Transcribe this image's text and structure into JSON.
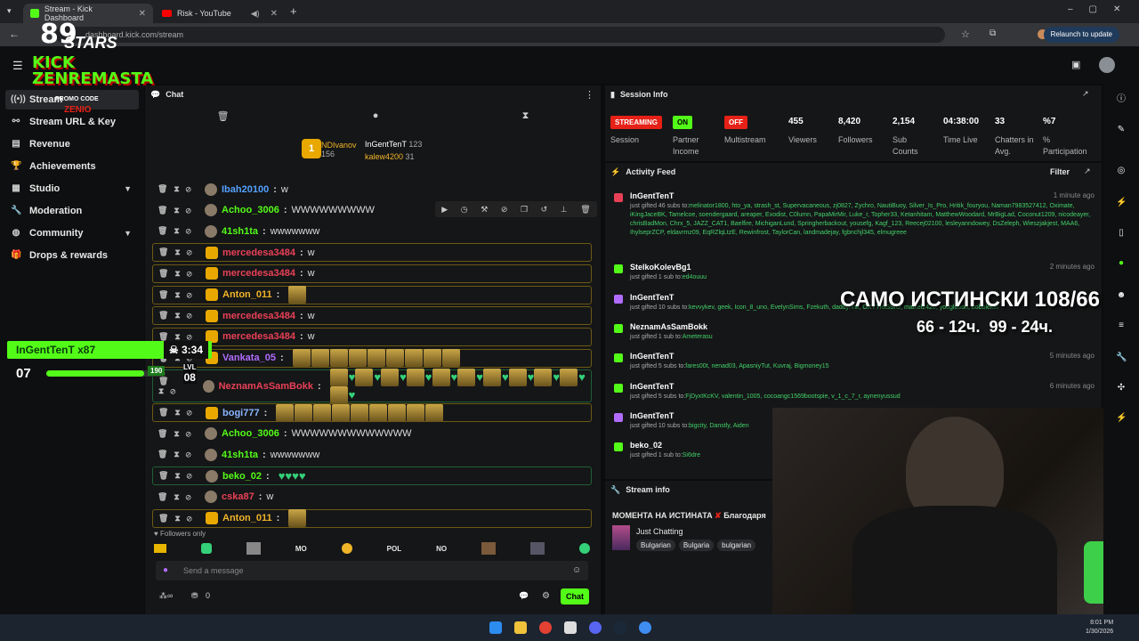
{
  "browser": {
    "tabs": [
      {
        "title": "Stream - Kick Dashboard",
        "color": "#53fc18"
      },
      {
        "title": "Risk - YouTube",
        "color": "#ff0000"
      }
    ],
    "url": "dashboard.kick.com/stream",
    "relaunch_label": "Relaunch to update"
  },
  "overlay": {
    "brand_top": "STARS",
    "brand_num": "89",
    "logo_main": "KICK ZENREMASTA",
    "logo_sub": "PROMO CODE",
    "logo_code": "ZENIO",
    "goal_user": "InGentTenT x87",
    "goal_time": "3:34",
    "level_left": "07",
    "level_right": "08",
    "level_prefix": "LVL",
    "goal_value": "190",
    "big_text": "САМО ИСТИНСКИ 108/66",
    "small_text": "66 - 12ч.  99 - 24ч."
  },
  "sidebar": {
    "items": [
      {
        "label": "Stream",
        "icon": "broadcast-icon"
      },
      {
        "label": "Stream URL & Key",
        "icon": "link-icon"
      },
      {
        "label": "Revenue",
        "icon": "chart-icon"
      },
      {
        "label": "Achievements",
        "icon": "trophy-icon"
      },
      {
        "label": "Studio",
        "icon": "layout-icon"
      },
      {
        "label": "Moderation",
        "icon": "wrench-icon"
      },
      {
        "label": "Community",
        "icon": "globe-icon"
      },
      {
        "label": "Drops & rewards",
        "icon": "gift-icon"
      }
    ]
  },
  "chat": {
    "title": "Chat",
    "leaderboard": [
      {
        "name": "NDIvanov",
        "count": "156"
      },
      {
        "name": "InGentTenT",
        "count": "123"
      },
      {
        "name": "kalew4200",
        "count": "31"
      }
    ],
    "messages": [
      {
        "user": "Ibah20100",
        "text": "w",
        "color": "#53a0ff",
        "box": ""
      },
      {
        "user": "Achoo_3006",
        "text": "WWWWWWWWW",
        "color": "#53fc18",
        "box": ""
      },
      {
        "user": "41sh1ta",
        "text": "wwwwwww",
        "color": "#53fc18",
        "box": ""
      },
      {
        "user": "mercedesa3484",
        "text": "w",
        "color": "#e94057",
        "box": "gold"
      },
      {
        "user": "mercedesa3484",
        "text": "w",
        "color": "#e94057",
        "box": "gold"
      },
      {
        "user": "Anton_011",
        "text": "",
        "color": "#f0b429",
        "box": "gold"
      },
      {
        "user": "mercedesa3484",
        "text": "w",
        "color": "#e94057",
        "box": "gold"
      },
      {
        "user": "mercedesa3484",
        "text": "w",
        "color": "#e94057",
        "box": "gold"
      },
      {
        "user": "Vankata_05",
        "text": "",
        "color": "#b16cff",
        "box": "gold"
      },
      {
        "user": "NeznamAsSamBokk",
        "text": "",
        "color": "#e94057",
        "box": "green"
      },
      {
        "user": "bogi777",
        "text": "",
        "color": "#8ab4ff",
        "box": "gold"
      },
      {
        "user": "Achoo_3006",
        "text": "WWWWWWWWWWWWW",
        "color": "#53fc18",
        "box": ""
      },
      {
        "user": "41sh1ta",
        "text": "wwwwwww",
        "color": "#53fc18",
        "box": ""
      },
      {
        "user": "beko_02",
        "text": "",
        "color": "#53fc18",
        "box": "green"
      },
      {
        "user": "cska87",
        "text": "w",
        "color": "#e94057",
        "box": ""
      },
      {
        "user": "Anton_011",
        "text": "",
        "color": "#f0b429",
        "box": "gold"
      }
    ],
    "followers_only": "Followers only",
    "emote_codes": [
      "MO",
      "POL",
      "NO"
    ],
    "input_placeholder": "Send a message",
    "points": "0",
    "send_label": "Chat"
  },
  "session": {
    "title": "Session Info",
    "streaming": "STREAMING",
    "on": "ON",
    "off": "OFF",
    "labels": [
      "Session",
      "Partner Income",
      "Multistream",
      "Viewers",
      "Followers",
      "Sub Counts",
      "Time Live",
      "Chatters in Avg.",
      "% Participation"
    ],
    "values": {
      "viewers": "455",
      "followers": "8,420",
      "subs": "2,154",
      "time": "04:38:00",
      "chatters": "33",
      "participation": "%7"
    }
  },
  "activity": {
    "title": "Activity Feed",
    "filter": "Filter",
    "items": [
      {
        "name": "InGentTenT",
        "time": "1 minute ago",
        "gift": "just gifted 46 subs to:",
        "names": "melinator1800, hto_ya, strash_st, Supervacaneous, zj0827, Zychro, NautiBuoy, Silver_Is_Pro, Hritik_fouryou, Naman7983527412, Oximate, iKingJaceBK, Tamelcoe, soendergaard, areaper, Exodist, C0lumn, PapaMirMir, Luke_r, Topher33, Ketanhitam, MatthewWoodard, MrBigLad, Coconut1209, nicodeayer, chrisBadMon, Chrx_5, JAZZ_CAT1, Baelfire, MichiganLund, Springherbackout, yousefg, Kagf_123, Reecej02100, lesleyanndowey, DsZeleph, Wieszjakjest, MAA6, IhylseprZCP, eldavrmz09, EqRZlqLtzE, Rewinfrost, TaylorCan, landmadejay, fgbnchjl345, elmugreee"
      },
      {
        "name": "StelkoKolevBg1",
        "time": "2 minutes ago",
        "gift": "just gifted 1 sub to:",
        "names": "ed4ouuu"
      },
      {
        "name": "InGentTenT",
        "time": "",
        "gift": "just gifted 10 subs to:",
        "names": "kevvykev, geek, Icon_8_uno, EvelynSims, Fzekuth, daddynnk, OXYTRISSIO, maikel2420, youglobon, bobbleker"
      },
      {
        "name": "NeznamAsSamBokk",
        "time": "",
        "gift": "just gifted 1 sub to:",
        "names": "Ameterasu"
      },
      {
        "name": "InGentTenT",
        "time": "5 minutes ago",
        "gift": "just gifted 5 subs to:",
        "names": "fares00t, nenad03, ApasniyTut, Kuvraj, Bigmoney15"
      },
      {
        "name": "InGentTenT",
        "time": "6 minutes ago",
        "gift": "just gifted 5 subs to:",
        "names": "FjDyxIKcKV, valentin_1005, cocoangc1569bootspie, v_1_c_7_r, aynenyussud"
      },
      {
        "name": "InGentTenT",
        "time": "",
        "gift": "just gifted 10 subs to:",
        "names": "bigcity, Danstly, Aiden"
      },
      {
        "name": "beko_02",
        "time": "",
        "gift": "just gifted 1 sub to:",
        "names": "Si6dre"
      }
    ]
  },
  "stream_info": {
    "title": "Stream info",
    "stream_title": "МОМЕНТА НА ИСТИНАТА",
    "stream_title_suffix": "Благодаря",
    "category": "Just Chatting",
    "tags": [
      "Bulgarian",
      "Bulgaria",
      "bulgarian"
    ]
  },
  "taskbar": {
    "time": "8:01 PM",
    "date": "1/30/2026"
  }
}
